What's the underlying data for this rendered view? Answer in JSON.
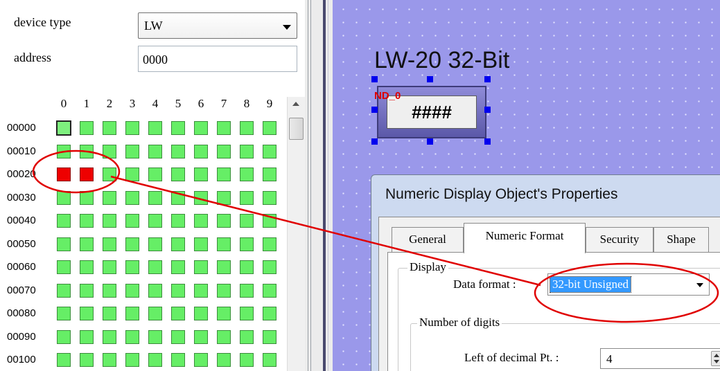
{
  "device_panel": {
    "device_type_label": "device type",
    "device_type_value": "LW",
    "address_label": "address",
    "address_value": "0000"
  },
  "grid": {
    "column_headers": [
      "0",
      "1",
      "2",
      "3",
      "4",
      "5",
      "6",
      "7",
      "8",
      "9"
    ],
    "row_labels": [
      "00000",
      "00010",
      "00020",
      "00030",
      "00040",
      "00050",
      "00060",
      "00070",
      "00080",
      "00090",
      "00100"
    ],
    "selected_cell": "00000",
    "highlighted_cells": [
      "00020",
      "00021"
    ]
  },
  "canvas": {
    "title": "LW-20 32-Bit",
    "object_label": "ND_0",
    "object_display": "####"
  },
  "dialog": {
    "title": "Numeric Display Object's Properties",
    "tabs": [
      "General",
      "Numeric Format",
      "Security",
      "Shape"
    ],
    "active_tab": "Numeric Format",
    "display_group": "Display",
    "data_format_label": "Data format :",
    "data_format_value": "32-bit Unsigned",
    "digits_group": "Number of digits",
    "left_of_decimal_label": "Left of decimal Pt. :",
    "left_of_decimal_value": "4"
  },
  "colors": {
    "cell_normal": "#66ee66",
    "cell_highlighted": "#ee0000",
    "canvas_background": "#9a98ea",
    "annotation": "#e00000",
    "selection": "#3399ff"
  }
}
